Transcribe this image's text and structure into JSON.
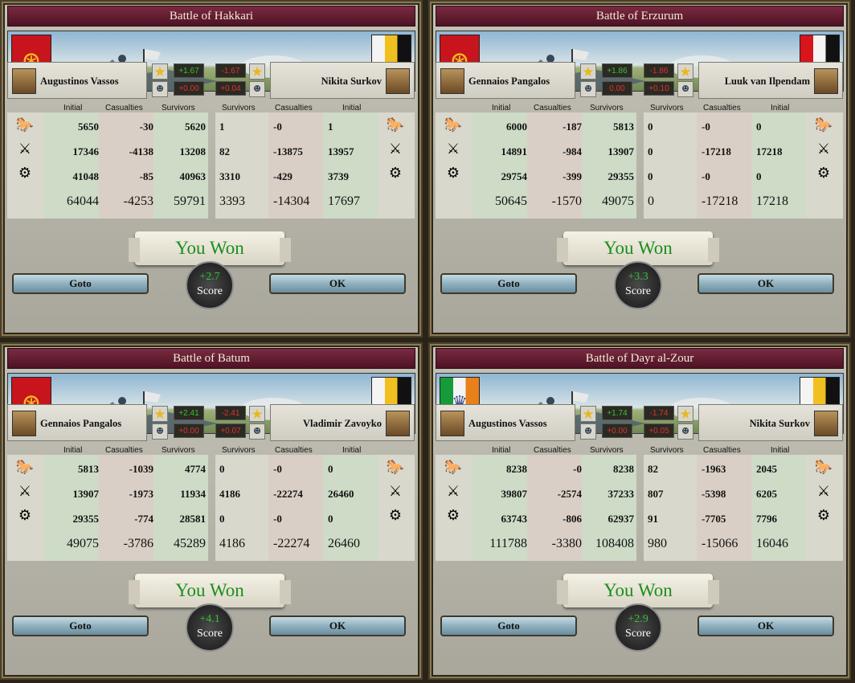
{
  "labels": {
    "initial": "Initial",
    "casualties": "Casualties",
    "survivors": "Survivors",
    "goto": "Goto",
    "ok": "OK",
    "score": "Score",
    "result": "You Won"
  },
  "colors": {
    "win": "#1b8e1b",
    "title_bar": "#6a2035",
    "positive": "#34c23a",
    "negative": "#e03030"
  },
  "battles": [
    {
      "title": "Battle of Hakkari",
      "attacker": {
        "name": "Augustinos Vassos",
        "star": "+1.67",
        "adv": "+0.00",
        "flag": "byzantine-eagle-flag",
        "rows": [
          {
            "initial": "5650",
            "casualties": "-30",
            "survivors": "5620"
          },
          {
            "initial": "17346",
            "casualties": "-4138",
            "survivors": "13208"
          },
          {
            "initial": "41048",
            "casualties": "-85",
            "survivors": "40963"
          }
        ],
        "totals": {
          "initial": "64044",
          "casualties": "-4253",
          "survivors": "59791"
        }
      },
      "defender": {
        "name": "Nikita Surkov",
        "star": "-1.67",
        "adv": "+0.04",
        "flag": "white-yellow-black-flag",
        "rows": [
          {
            "survivors": "1",
            "casualties": "-0",
            "initial": "1"
          },
          {
            "survivors": "82",
            "casualties": "-13875",
            "initial": "13957"
          },
          {
            "survivors": "3310",
            "casualties": "-429",
            "initial": "3739"
          }
        ],
        "totals": {
          "survivors": "3393",
          "casualties": "-14304",
          "initial": "17697"
        }
      },
      "score": "+2.7"
    },
    {
      "title": "Battle of Erzurum",
      "attacker": {
        "name": "Gennaios Pangalos",
        "star": "+1.86",
        "adv": "0.00",
        "flag": "byzantine-eagle-flag",
        "rows": [
          {
            "initial": "6000",
            "casualties": "-187",
            "survivors": "5813"
          },
          {
            "initial": "14891",
            "casualties": "-984",
            "survivors": "13907"
          },
          {
            "initial": "29754",
            "casualties": "-399",
            "survivors": "29355"
          }
        ],
        "totals": {
          "initial": "50645",
          "casualties": "-1570",
          "survivors": "49075"
        }
      },
      "defender": {
        "name": "Luuk van Ilpendam",
        "star": "-1.86",
        "adv": "+0.10",
        "flag": "red-white-black-flag",
        "rows": [
          {
            "survivors": "0",
            "casualties": "-0",
            "initial": "0"
          },
          {
            "survivors": "0",
            "casualties": "-17218",
            "initial": "17218"
          },
          {
            "survivors": "0",
            "casualties": "-0",
            "initial": "0"
          }
        ],
        "totals": {
          "survivors": "0",
          "casualties": "-17218",
          "initial": "17218"
        }
      },
      "score": "+3.3"
    },
    {
      "title": "Battle of Batum",
      "attacker": {
        "name": "Gennaios Pangalos",
        "star": "+2.41",
        "adv": "+0.00",
        "flag": "byzantine-eagle-flag",
        "rows": [
          {
            "initial": "5813",
            "casualties": "-1039",
            "survivors": "4774"
          },
          {
            "initial": "13907",
            "casualties": "-1973",
            "survivors": "11934"
          },
          {
            "initial": "29355",
            "casualties": "-774",
            "survivors": "28581"
          }
        ],
        "totals": {
          "initial": "49075",
          "casualties": "-3786",
          "survivors": "45289"
        }
      },
      "defender": {
        "name": "Vladimir Zavoyko",
        "star": "-2.41",
        "adv": "+0.07",
        "flag": "white-yellow-black-flag",
        "rows": [
          {
            "survivors": "0",
            "casualties": "-0",
            "initial": "0"
          },
          {
            "survivors": "4186",
            "casualties": "-22274",
            "initial": "26460"
          },
          {
            "survivors": "0",
            "casualties": "-0",
            "initial": "0"
          }
        ],
        "totals": {
          "survivors": "4186",
          "casualties": "-22274",
          "initial": "26460"
        }
      },
      "score": "+4.1"
    },
    {
      "title": "Battle of Dayr al-Zour",
      "attacker": {
        "name": "Augustinos Vassos",
        "star": "+1.74",
        "adv": "+0.00",
        "flag": "green-white-orange-flag",
        "rows": [
          {
            "initial": "8238",
            "casualties": "-0",
            "survivors": "8238"
          },
          {
            "initial": "39807",
            "casualties": "-2574",
            "survivors": "37233"
          },
          {
            "initial": "63743",
            "casualties": "-806",
            "survivors": "62937"
          }
        ],
        "totals": {
          "initial": "111788",
          "casualties": "-3380",
          "survivors": "108408"
        }
      },
      "defender": {
        "name": "Nikita Surkov",
        "star": "-1.74",
        "adv": "+0.05",
        "flag": "white-yellow-black-flag",
        "rows": [
          {
            "survivors": "82",
            "casualties": "-1963",
            "initial": "2045"
          },
          {
            "survivors": "807",
            "casualties": "-5398",
            "initial": "6205"
          },
          {
            "survivors": "91",
            "casualties": "-7705",
            "initial": "7796"
          }
        ],
        "totals": {
          "survivors": "980",
          "casualties": "-15066",
          "initial": "16046"
        }
      },
      "score": "+2.9"
    }
  ]
}
